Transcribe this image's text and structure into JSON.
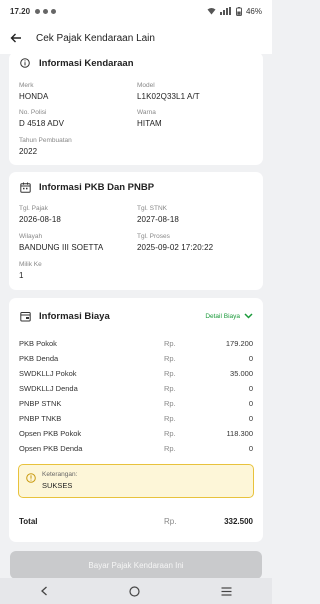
{
  "status_bar": {
    "time": "17.20",
    "battery": "46%"
  },
  "appbar": {
    "title": "Cek Pajak Kendaraan Lain"
  },
  "vehicle_info": {
    "title": "Informasi Kendaraan",
    "fields": [
      {
        "label": "Merk",
        "value": "HONDA"
      },
      {
        "label": "Model",
        "value": "L1K02Q33L1 A/T"
      },
      {
        "label": "No. Polisi",
        "value": "D 4518 ADV"
      },
      {
        "label": "Warna",
        "value": "HITAM"
      },
      {
        "label": "Tahun Pembuatan",
        "value": "2022"
      }
    ]
  },
  "pkb_info": {
    "title": "Informasi PKB Dan PNBP",
    "fields": [
      {
        "label": "Tgl. Pajak",
        "value": "2026-08-18"
      },
      {
        "label": "Tgl. STNK",
        "value": "2027-08-18"
      },
      {
        "label": "Wilayah",
        "value": "BANDUNG III SOETTA"
      },
      {
        "label": "Tgl. Proses",
        "value": "2025-09-02 17:20:22"
      },
      {
        "label": "Milik Ke",
        "value": "1"
      }
    ]
  },
  "cost_info": {
    "title": "Informasi Biaya",
    "detail_label": "Detail Biaya",
    "currency": "Rp.",
    "rows": [
      {
        "label": "PKB Pokok",
        "value": "179.200"
      },
      {
        "label": "PKB Denda",
        "value": "0"
      },
      {
        "label": "SWDKLLJ Pokok",
        "value": "35.000"
      },
      {
        "label": "SWDKLLJ Denda",
        "value": "0"
      },
      {
        "label": "PNBP STNK",
        "value": "0"
      },
      {
        "label": "PNBP TNKB",
        "value": "0"
      },
      {
        "label": "Opsen PKB Pokok",
        "value": "118.300"
      },
      {
        "label": "Opsen PKB Denda",
        "value": "0"
      }
    ],
    "note_label": "Keterangan:",
    "note_value": "SUKSES",
    "total_label": "Total",
    "total_value": "332.500"
  },
  "pay_button": "Bayar Pajak Kendaraan Ini",
  "colors": {
    "accent": "#1a9a3a",
    "note_bg": "#fdf6d8",
    "note_border": "#e8c23c"
  }
}
